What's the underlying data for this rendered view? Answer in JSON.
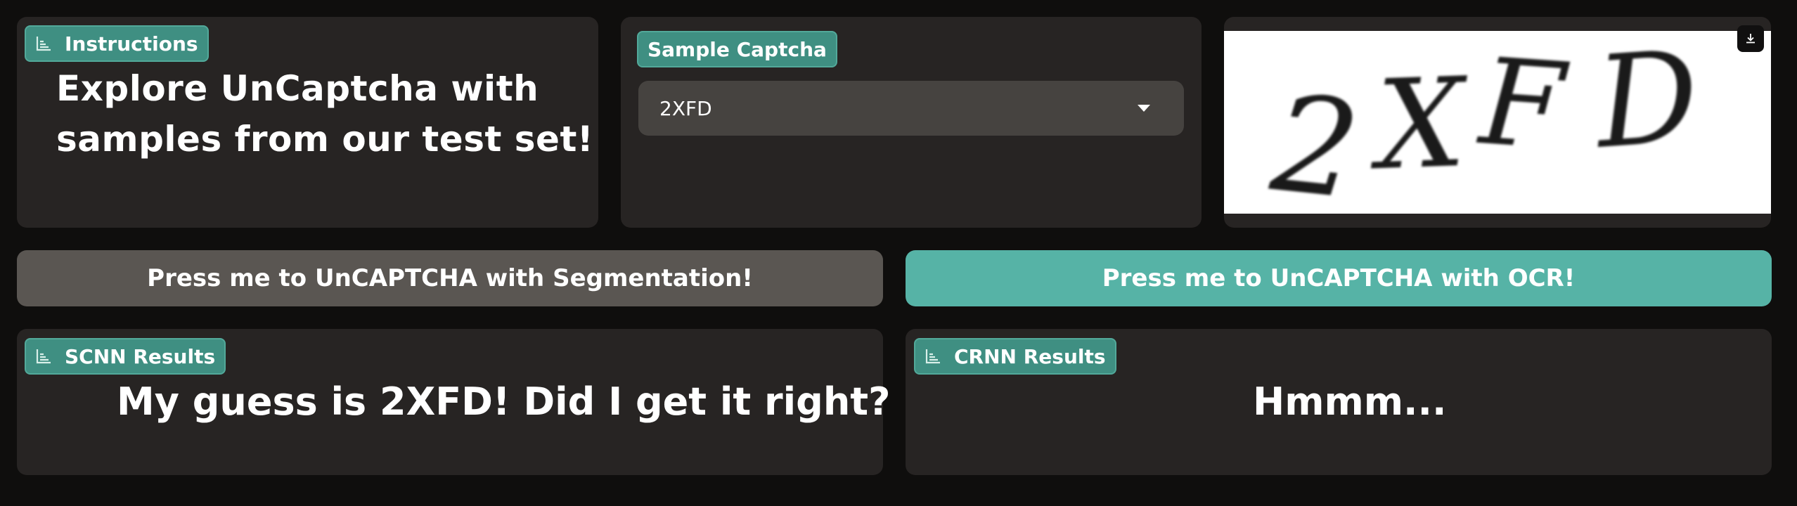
{
  "instructions": {
    "badge_label": "Instructions",
    "badge_icon": "chart-icon",
    "line1": "Explore UnCaptcha with",
    "line2": "samples from our test set!"
  },
  "sample": {
    "badge_label": "Sample Captcha",
    "selected_value": "2XFD",
    "dropdown_icon": "chevron-down-icon"
  },
  "captcha_image": {
    "characters": [
      "2",
      "X",
      "F",
      "D"
    ],
    "download_icon": "download-icon"
  },
  "buttons": {
    "segmentation_label": "Press me to UnCAPTCHA with Segmentation!",
    "ocr_label": "Press me to UnCAPTCHA with OCR!",
    "segmentation_color": "#5a5652",
    "ocr_color": "#56b3a6"
  },
  "scnn": {
    "badge_label": "SCNN Results",
    "badge_icon": "chart-icon",
    "result": "My guess is 2XFD! Did I get it right?"
  },
  "crnn": {
    "badge_label": "CRNN Results",
    "badge_icon": "chart-icon",
    "result": "Hmmm..."
  },
  "colors": {
    "background": "#0f0e0d",
    "panel": "#272423",
    "accent": "#3f8f82"
  }
}
